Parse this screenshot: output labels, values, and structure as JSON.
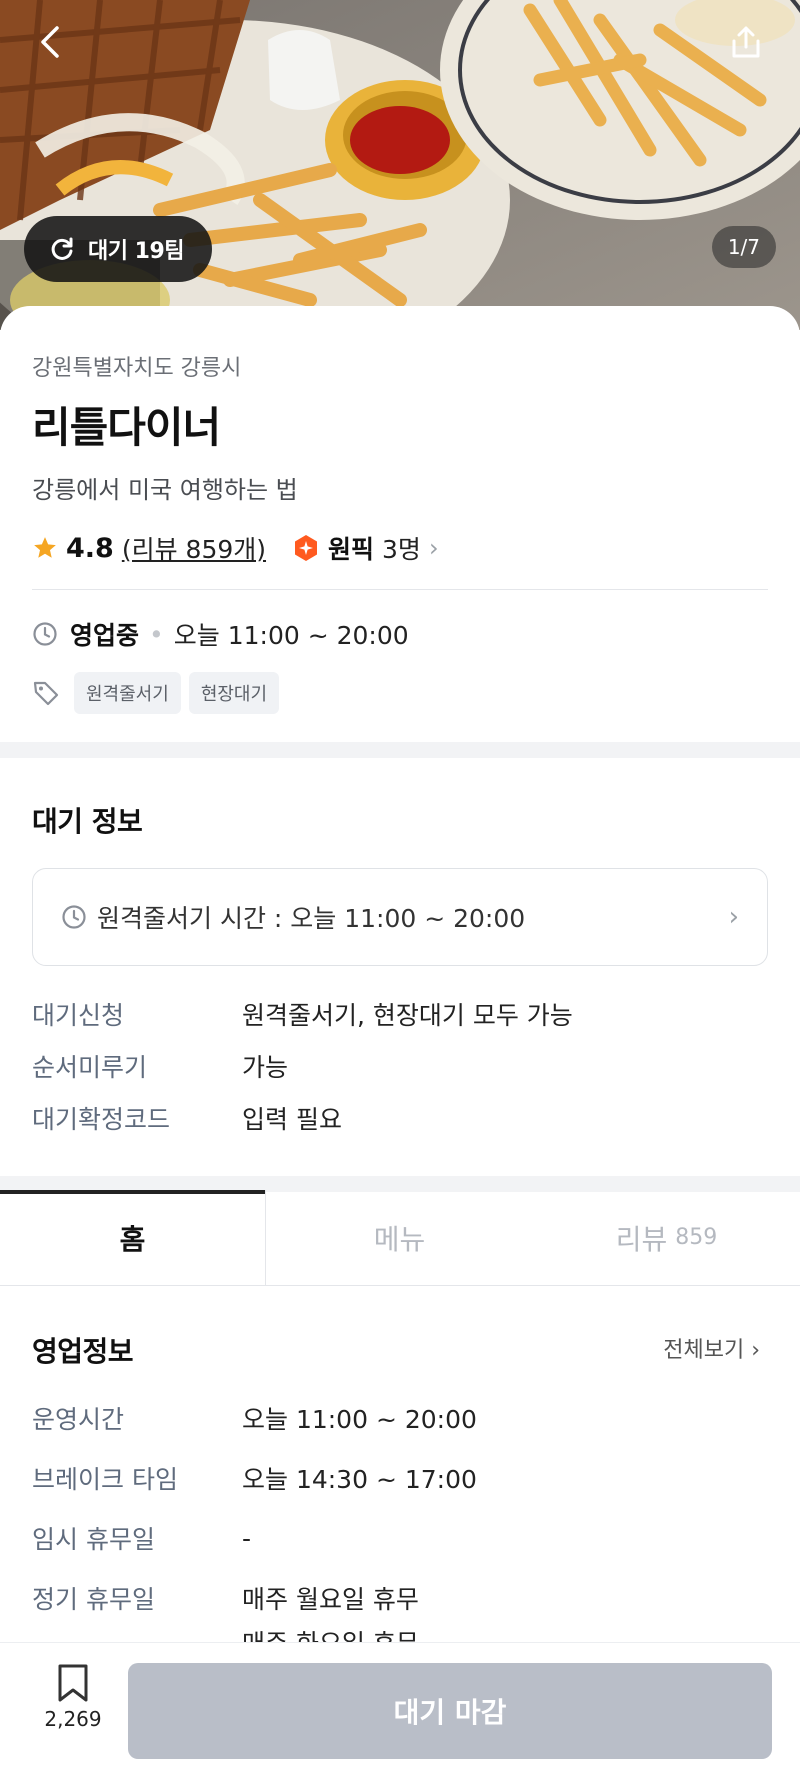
{
  "hero": {
    "wait_text": "대기 19팀",
    "counter": "1/7"
  },
  "store": {
    "region": "강원특별자치도 강릉시",
    "name": "리틀다이너",
    "tagline": "강릉에서 미국 여행하는 법",
    "rating": "4.8",
    "review_label": "(리뷰 859개)",
    "pick_label": "원픽",
    "pick_count": "3명",
    "status": "영업중",
    "hours": "오늘 11:00 ~ 20:00",
    "tags": [
      "원격줄서기",
      "현장대기"
    ]
  },
  "wait_info": {
    "title": "대기 정보",
    "remote_time": "원격줄서기 시간 : 오늘 11:00 ~ 20:00",
    "rows": [
      {
        "key": "대기신청",
        "value": "원격줄서기, 현장대기 모두 가능"
      },
      {
        "key": "순서미루기",
        "value": "가능"
      },
      {
        "key": "대기확정코드",
        "value": "입력 필요"
      }
    ]
  },
  "tabs": [
    {
      "label": "홈",
      "count": ""
    },
    {
      "label": "메뉴",
      "count": ""
    },
    {
      "label": "리뷰",
      "count": "859"
    }
  ],
  "business": {
    "title": "영업정보",
    "view_all": "전체보기",
    "rows": [
      {
        "key": "운영시간",
        "value": "오늘 11:00 ~ 20:00"
      },
      {
        "key": "브레이크 타임",
        "value": "오늘 14:30 ~ 17:00"
      },
      {
        "key": "임시 휴무일",
        "value": "-"
      },
      {
        "key": "정기 휴무일",
        "value": "매주 월요일 휴무"
      },
      {
        "key": "",
        "value": "매주 화요일 휴무"
      }
    ]
  },
  "bottom": {
    "bookmark_count": "2,269",
    "cta_label": "대기 마감"
  },
  "colors": {
    "star": "#f5a623",
    "pick_badge": "#ff5a1f",
    "cta_disabled": "#b9bec8",
    "label_gray": "#5f6b7d"
  }
}
